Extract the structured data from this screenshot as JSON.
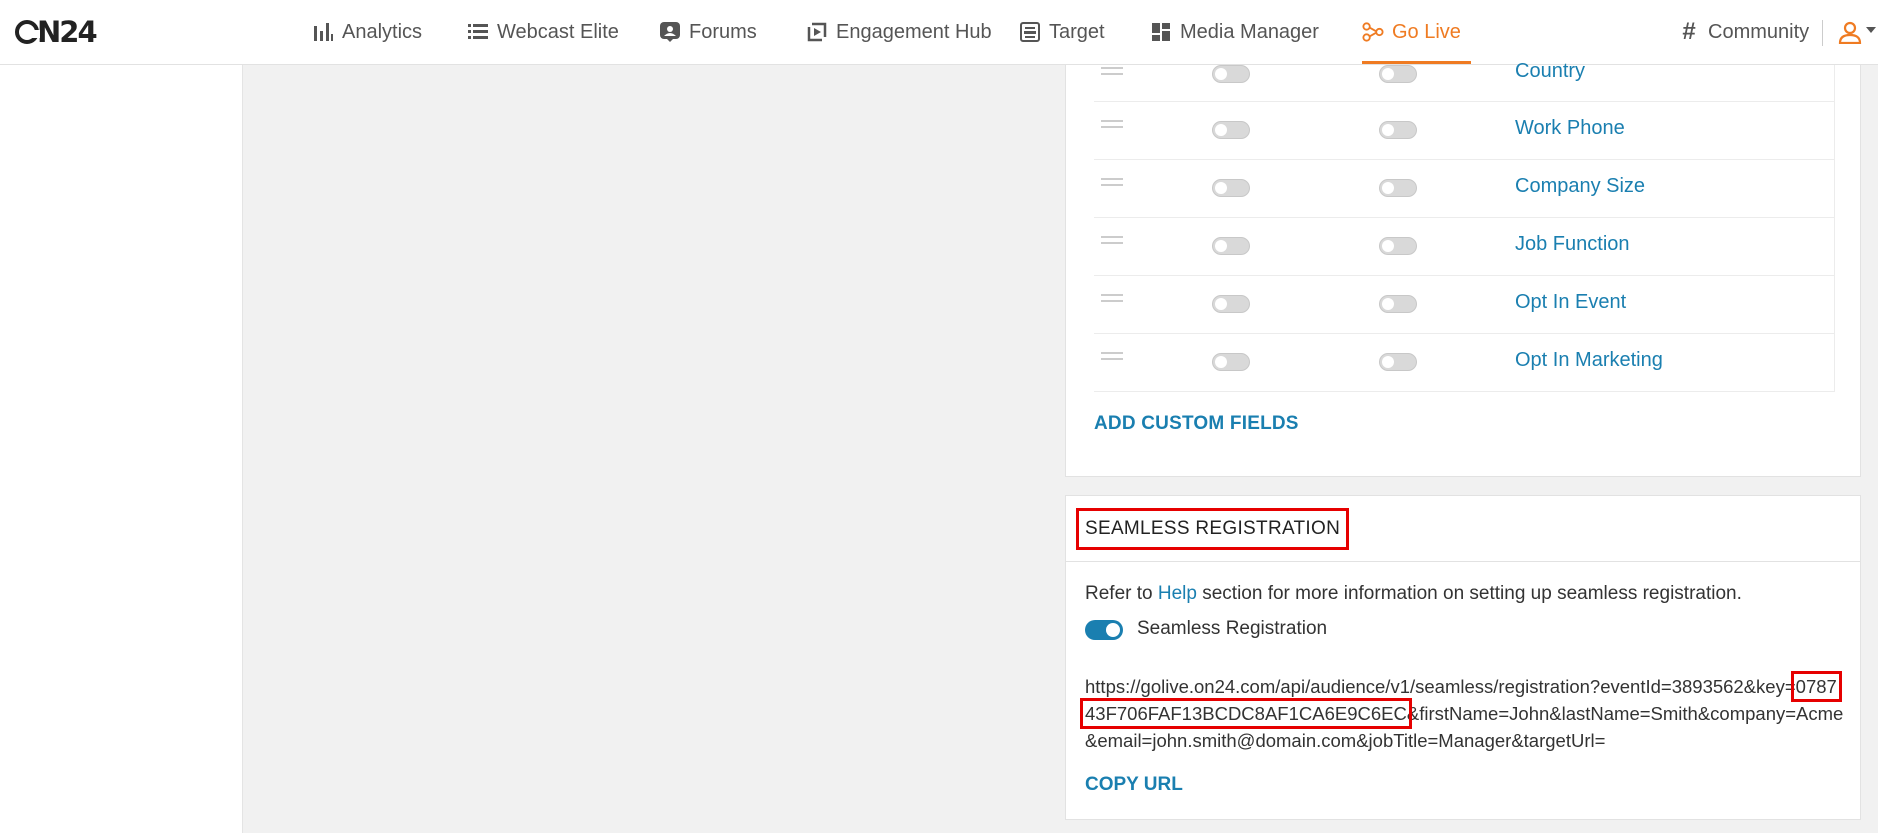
{
  "brand": {
    "logo_text": "N24",
    "logo_ring": "O"
  },
  "nav": {
    "items": [
      {
        "label": "Analytics",
        "icon": "bar-chart-icon"
      },
      {
        "label": "Webcast Elite",
        "icon": "list-icon"
      },
      {
        "label": "Forums",
        "icon": "forum-icon"
      },
      {
        "label": "Engagement Hub",
        "icon": "hub-icon"
      },
      {
        "label": "Target",
        "icon": "target-icon"
      },
      {
        "label": "Media Manager",
        "icon": "grid-icon"
      },
      {
        "label": "Go Live",
        "icon": "go-live-icon",
        "active": true
      },
      {
        "label": "Community",
        "icon": "hash-icon"
      }
    ]
  },
  "fields": {
    "rows": [
      {
        "label": "Country"
      },
      {
        "label": "Work Phone"
      },
      {
        "label": "Company Size"
      },
      {
        "label": "Job Function"
      },
      {
        "label": "Opt In Event"
      },
      {
        "label": "Opt In Marketing"
      }
    ],
    "add_custom_label": "ADD CUSTOM FIELDS"
  },
  "seamless": {
    "title": "SEAMLESS REGISTRATION",
    "help_prefix": "Refer to ",
    "help_link": "Help",
    "help_suffix": " section for more information on setting up seamless registration.",
    "toggle_label": "Seamless Registration",
    "toggle_on": true,
    "url_prefix": "https://golive.on24.com/api/audience/v1/seamless/registration?eventId=3893562&key=",
    "url_key": "078743F706FAF13BCDC8AF1CA6E9C6EC",
    "url_suffix": "&firstName=John&lastName=Smith&company=Acme&email=john.smith@domain.com&jobTitle=Manager&targetUrl=",
    "copy_label": "COPY URL"
  },
  "colors": {
    "accent": "#ef7b22",
    "link": "#1a7fb0",
    "highlight": "#e60000"
  }
}
